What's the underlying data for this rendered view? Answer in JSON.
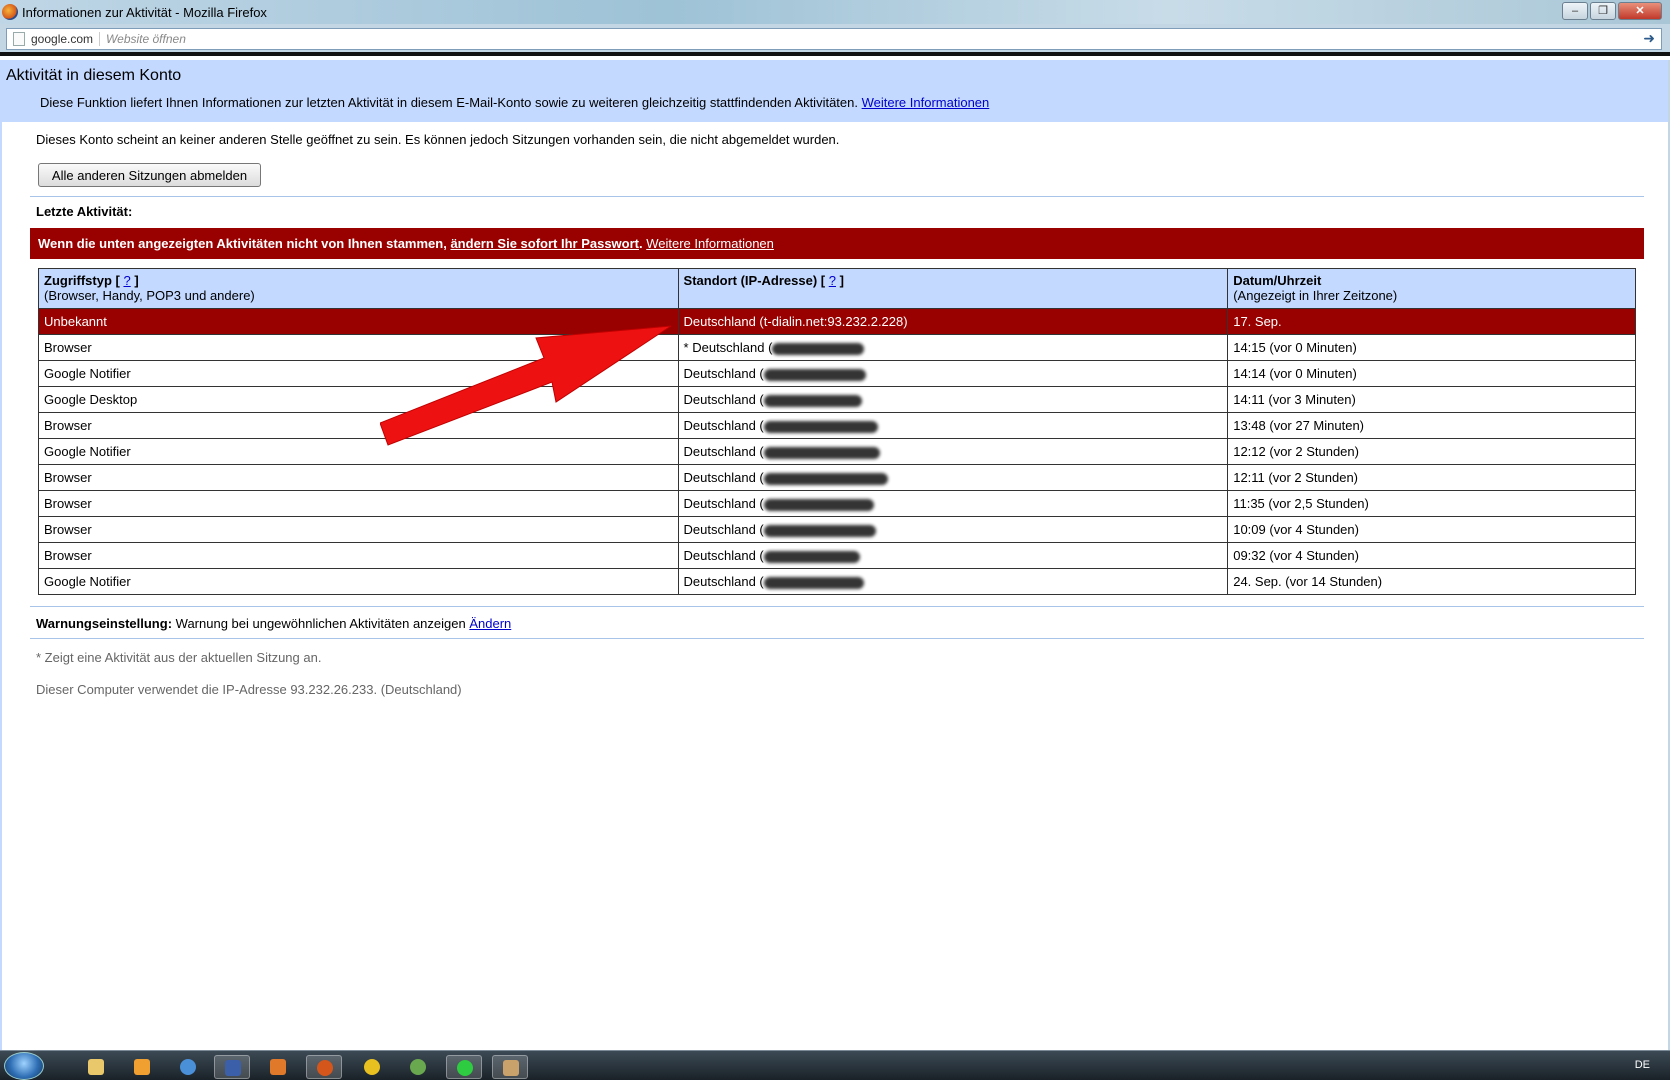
{
  "window": {
    "title": "Informationen zur Aktivität - Mozilla Firefox"
  },
  "urlbar": {
    "domain": "google.com",
    "placeholder": "Website öffnen"
  },
  "header": {
    "title": "Aktivität in diesem Konto",
    "description": "Diese Funktion liefert Ihnen Informationen zur letzten Aktivität in diesem E-Mail-Konto sowie zu weiteren gleichzeitig stattfindenden Aktivitäten.",
    "more_info_link": "Weitere Informationen"
  },
  "status": {
    "text": "Dieses Konto scheint an keiner anderen Stelle geöffnet zu sein. Es können jedoch Sitzungen vorhanden sein, die nicht abgemeldet wurden.",
    "signout_button": "Alle anderen Sitzungen abmelden"
  },
  "recent": {
    "label": "Letzte Aktivität:",
    "warning_text": "Wenn die unten angezeigten Aktivitäten nicht von Ihnen stammen,",
    "change_password_link": "ändern Sie sofort Ihr Passwort",
    "more_info_link": "Weitere Informationen"
  },
  "table": {
    "col1_title": "Zugriffstyp [",
    "col1_help": "?",
    "col1_close": "]",
    "col1_sub": "(Browser, Handy, POP3 und andere)",
    "col2_title": "Standort (IP-Adresse) [",
    "col2_help": "?",
    "col2_close": "]",
    "col3_title": "Datum/Uhrzeit",
    "col3_sub": "(Angezeigt in Ihrer Zeitzone)",
    "rows": [
      {
        "type": "Unbekannt",
        "location": "Deutschland (t-dialin.net:93.232.2.228)",
        "time": "17. Sep."
      },
      {
        "type": "Browser",
        "location": "* Deutschland (",
        "time": "14:15 (vor 0 Minuten)"
      },
      {
        "type": "Google Notifier",
        "location": "Deutschland (",
        "time": "14:14 (vor 0 Minuten)"
      },
      {
        "type": "Google Desktop",
        "location": "Deutschland (",
        "time": "14:11 (vor 3 Minuten)"
      },
      {
        "type": "Browser",
        "location": "Deutschland (",
        "time": "13:48 (vor 27 Minuten)"
      },
      {
        "type": "Google Notifier",
        "location": "Deutschland (",
        "time": "12:12 (vor 2 Stunden)"
      },
      {
        "type": "Browser",
        "location": "Deutschland (",
        "time": "12:11 (vor 2 Stunden)"
      },
      {
        "type": "Browser",
        "location": "Deutschland (",
        "time": "11:35 (vor 2,5 Stunden)"
      },
      {
        "type": "Browser",
        "location": "Deutschland (",
        "time": "10:09 (vor 4 Stunden)"
      },
      {
        "type": "Browser",
        "location": "Deutschland (",
        "time": "09:32 (vor 4 Stunden)"
      },
      {
        "type": "Google Notifier",
        "location": "Deutschland (",
        "time": "24. Sep. (vor 14 Stunden)"
      }
    ]
  },
  "warning_setting": {
    "label": "Warnungseinstellung:",
    "text": "Warnung bei ungewöhnlichen Aktivitäten anzeigen",
    "change_link": "Ändern"
  },
  "footnote": "* Zeigt eine Aktivität aus der aktuellen Sitzung an.",
  "ip_note": "Dieser Computer verwendet die IP-Adresse 93.232.26.233. (Deutschland)",
  "taskbar": {
    "language": "DE"
  },
  "colors": {
    "header_band": "#c3d9ff",
    "warning_red": "#990000",
    "arrow_red": "#ee1111"
  }
}
